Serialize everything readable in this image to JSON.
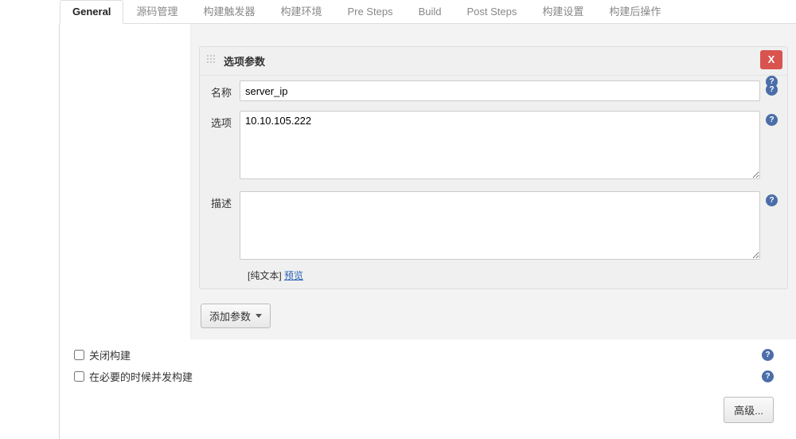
{
  "tabs": {
    "general": "General",
    "scm": "源码管理",
    "triggers": "构建触发器",
    "env": "构建环境",
    "pre": "Pre Steps",
    "build": "Build",
    "post": "Post Steps",
    "settings": "构建设置",
    "postbuild": "构建后操作"
  },
  "panel": {
    "title": "选项参数",
    "close": "X",
    "name_label": "名称",
    "name_value": "server_ip",
    "choices_label": "选项",
    "choices_value": "10.10.105.222",
    "desc_label": "描述",
    "desc_value": "",
    "hint_prefix": "[纯文本] ",
    "hint_link": "预览"
  },
  "add_param": "添加参数",
  "checkboxes": {
    "disable": "关闭构建",
    "concurrent": "在必要的时候并发构建"
  },
  "advanced": "高级...",
  "help_glyph": "?"
}
